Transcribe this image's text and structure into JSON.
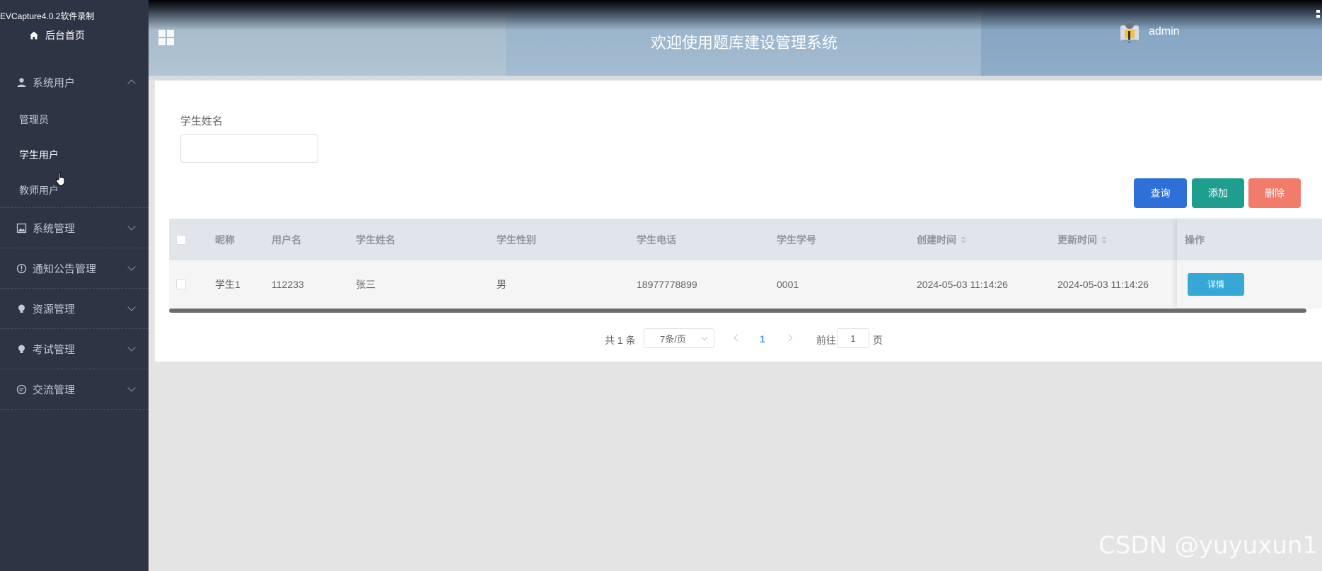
{
  "recorder_label": "EVCapture4.0.2软件录制",
  "sidebar": {
    "home_label": "后台首页",
    "groups": [
      {
        "label": "系统用户",
        "icon": "user-icon",
        "expanded": true,
        "items": [
          {
            "label": "管理员"
          },
          {
            "label": "学生用户",
            "active": true
          },
          {
            "label": "教师用户"
          }
        ]
      },
      {
        "label": "系统管理",
        "icon": "image-icon"
      },
      {
        "label": "通知公告管理",
        "icon": "info-icon"
      },
      {
        "label": "资源管理",
        "icon": "bulb-icon"
      },
      {
        "label": "考试管理",
        "icon": "bulb-icon"
      },
      {
        "label": "交流管理",
        "icon": "chat-icon"
      }
    ]
  },
  "header": {
    "title": "欢迎使用题库建设管理系统",
    "user": "admin",
    "menu_icon": "grid-icon"
  },
  "search": {
    "label": "学生姓名",
    "value": "",
    "placeholder": ""
  },
  "actions": {
    "query": "查询",
    "add": "添加",
    "delete": "删除"
  },
  "table": {
    "columns": [
      "昵称",
      "用户名",
      "学生姓名",
      "学生性别",
      "学生电话",
      "学生学号",
      "创建时间",
      "更新时间",
      "操作"
    ],
    "rows": [
      {
        "nickname": "学生1",
        "username": "112233",
        "name": "张三",
        "gender": "男",
        "phone": "18977778899",
        "student_no": "0001",
        "created": "2024-05-03 11:14:26",
        "updated": "2024-05-03 11:14:26",
        "action": "详情"
      }
    ]
  },
  "pagination": {
    "total": "共 1 条",
    "page_size": "7条/页",
    "current_page": "1",
    "goto_label": "前往",
    "goto_value": "1",
    "page_unit": "页"
  },
  "watermark": "CSDN @yuyuxun1",
  "colors": {
    "sidebar_bg": "#2d3444",
    "query_btn": "#2f6fd8",
    "add_btn": "#1d9e8f",
    "delete_btn": "#f27c6c",
    "detail_btn": "#35a8d6"
  }
}
